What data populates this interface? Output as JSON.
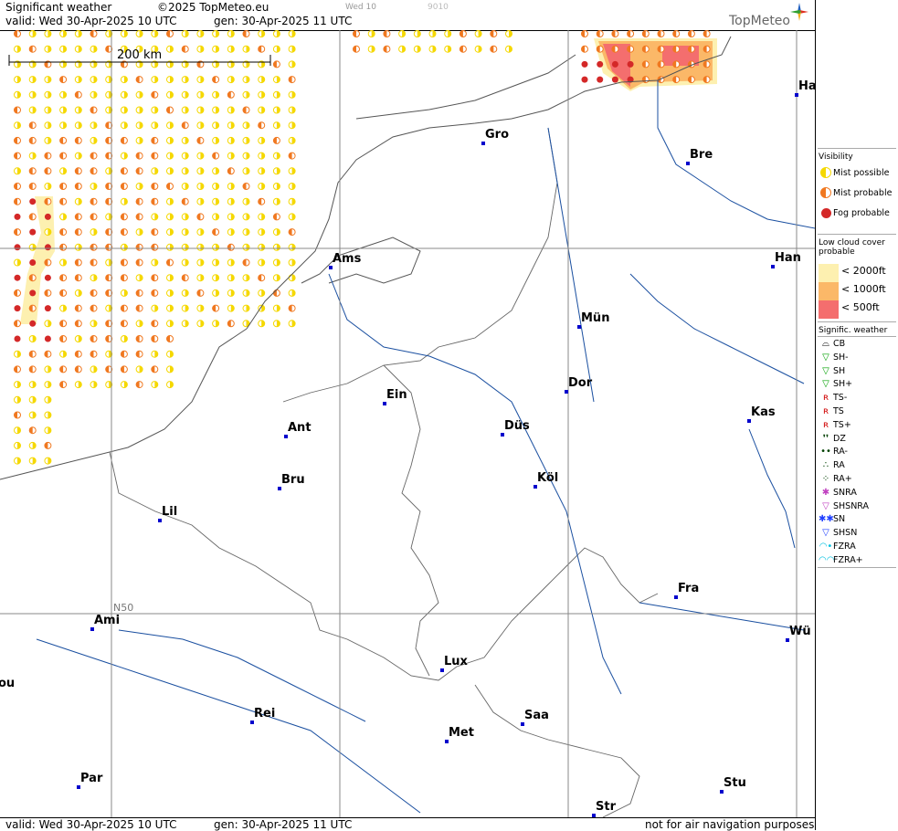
{
  "header": {
    "product": "Significant weather",
    "copyright": "©2025 TopMeteo.eu",
    "valid": "valid:  Wed  30-Apr-2025  10 UTC",
    "generated": "gen: 30-Apr-2025 11 UTC",
    "faint1": "Wed 10",
    "faint2": "9010",
    "brand": "TopMeteo"
  },
  "footer": {
    "valid": "valid:  Wed  30-Apr-2025  10 UTC",
    "generated": "gen: 30-Apr-2025 11 UTC",
    "disclaimer": "not for air navigation purposes"
  },
  "scale_label": "200 km",
  "lat_label": "N50",
  "cities": [
    {
      "name": "Gro"
    },
    {
      "name": "Bre"
    },
    {
      "name": "Ha"
    },
    {
      "name": "Ams"
    },
    {
      "name": "Han"
    },
    {
      "name": "Mün"
    },
    {
      "name": "Dor"
    },
    {
      "name": "Ein"
    },
    {
      "name": "Ant"
    },
    {
      "name": "Düs"
    },
    {
      "name": "Kas"
    },
    {
      "name": "Bru"
    },
    {
      "name": "Köl"
    },
    {
      "name": "Lil"
    },
    {
      "name": "Fra"
    },
    {
      "name": "Ami"
    },
    {
      "name": "Wü"
    },
    {
      "name": "Lux"
    },
    {
      "name": "ou"
    },
    {
      "name": "Rei"
    },
    {
      "name": "Saa"
    },
    {
      "name": "Met"
    },
    {
      "name": "Par"
    },
    {
      "name": "Stu"
    },
    {
      "name": "Str"
    }
  ],
  "legend": {
    "visibility_title": "Visibility",
    "visibility": [
      {
        "label": "Mist possible",
        "color": "#f5d800"
      },
      {
        "label": "Mist probable",
        "color": "#f07820"
      },
      {
        "label": "Fog probable",
        "color": "#d42828"
      }
    ],
    "cloud_title_1": "Low cloud cover",
    "cloud_title_2": "probable",
    "cloud": [
      {
        "label": "< 2000ft",
        "color": "#fdf0b0"
      },
      {
        "label": "< 1000ft",
        "color": "#fbb868"
      },
      {
        "label": "<   500ft",
        "color": "#f46e6e"
      }
    ],
    "weather_title": "Signific. weather",
    "weather": [
      {
        "label": "CB",
        "icon": "cb-icon",
        "color": "#000000"
      },
      {
        "label": "SH-",
        "icon": "shower-light-icon",
        "color": "#00a000"
      },
      {
        "label": "SH",
        "icon": "shower-icon",
        "color": "#00a000"
      },
      {
        "label": "SH+",
        "icon": "shower-heavy-icon",
        "color": "#00a000"
      },
      {
        "label": "TS-",
        "icon": "thunder-light-icon",
        "color": "#d00000"
      },
      {
        "label": "TS",
        "icon": "thunder-icon",
        "color": "#d00000"
      },
      {
        "label": "TS+",
        "icon": "thunder-heavy-icon",
        "color": "#d00000"
      },
      {
        "label": "DZ",
        "icon": "drizzle-icon",
        "color": "#004000"
      },
      {
        "label": "RA-",
        "icon": "rain-light-icon",
        "color": "#004000"
      },
      {
        "label": "RA",
        "icon": "rain-icon",
        "color": "#004000"
      },
      {
        "label": "RA+",
        "icon": "rain-heavy-icon",
        "color": "#004000"
      },
      {
        "label": "SNRA",
        "icon": "sleet-icon",
        "color": "#c040c0"
      },
      {
        "label": "SHSNRA",
        "icon": "sleet-shower-icon",
        "color": "#c040c0"
      },
      {
        "label": "SN",
        "icon": "snow-icon",
        "color": "#2040ff"
      },
      {
        "label": "SHSN",
        "icon": "snow-shower-icon",
        "color": "#2040ff"
      },
      {
        "label": "FZRA",
        "icon": "freezing-rain-icon",
        "color": "#00c0e0"
      },
      {
        "label": "FZRA+",
        "icon": "freezing-rain-heavy-icon",
        "color": "#00c0e0"
      }
    ]
  }
}
